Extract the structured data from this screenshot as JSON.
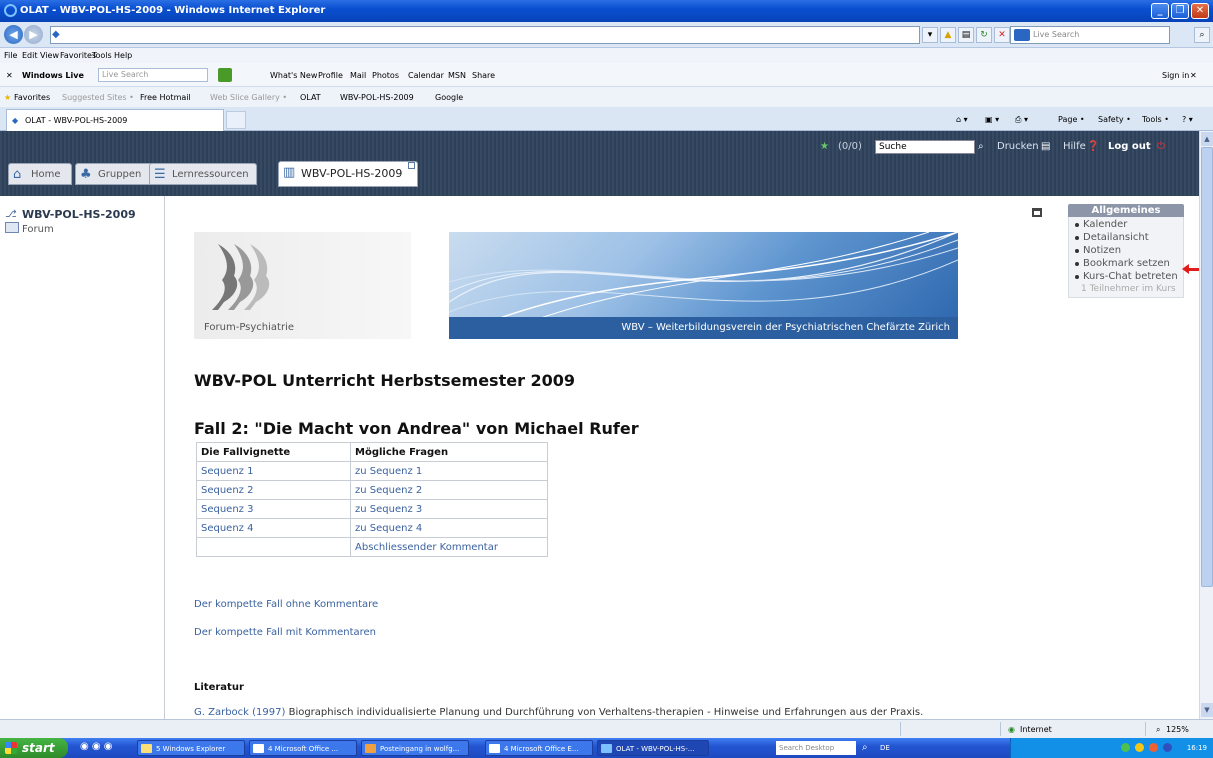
{
  "window": {
    "title": "OLAT - WBV-POL-HS-2009 - Windows Internet Explorer"
  },
  "ie": {
    "menu": [
      "File",
      "Edit",
      "View",
      "Favorites",
      "Tools",
      "Help"
    ],
    "live_search_placeholder": "Live Search",
    "live_toolbar": {
      "brand": "Windows Live",
      "search_placeholder": "Live Search",
      "links": [
        "What's New",
        "Profile",
        "Mail",
        "Photos",
        "Calendar",
        "MSN",
        "Share"
      ],
      "sign_in": "Sign in"
    },
    "favorites": {
      "label": "Favorites",
      "items": [
        "Suggested Sites •",
        "Free Hotmail",
        "Web Slice Gallery •",
        "OLAT",
        "WBV-POL-HS-2009",
        "Google"
      ]
    },
    "tab_title": "OLAT - WBV-POL-HS-2009",
    "commands": [
      "Page •",
      "Safety •",
      "Tools •"
    ]
  },
  "olat": {
    "header": {
      "count": "(0/0)",
      "search_value": "Suche",
      "print": "Drucken",
      "help": "Hilfe",
      "logout": "Log out"
    },
    "tabs": [
      {
        "label": "Home"
      },
      {
        "label": "Gruppen"
      },
      {
        "label": "Lernressourcen"
      },
      {
        "label": "WBV-POL-HS-2009"
      }
    ],
    "nav": {
      "course": "WBV-POL-HS-2009",
      "forum": "Forum"
    },
    "toolbox": {
      "title": "Allgemeines",
      "items": [
        "Kalender",
        "Detailansicht",
        "Notizen",
        "Bookmark setzen",
        "Kurs-Chat betreten"
      ],
      "note": "1 Teilnehmer im Kurs"
    },
    "banner": {
      "left_caption": "Forum-Psychiatrie",
      "right_caption": "WBV – Weiterbildungsverein der Psychiatrischen Chefärzte Zürich"
    },
    "content": {
      "heading": "WBV-POL Unterricht Herbstsemester 2009",
      "case_title": "Fall 2: \"Die Macht von Andrea\" von Michael Rufer",
      "table": {
        "headers": [
          "Die Fallvignette",
          "Mögliche Fragen"
        ],
        "rows": [
          [
            "Sequenz 1",
            "zu Sequenz 1"
          ],
          [
            "Sequenz 2",
            "zu Sequenz 2"
          ],
          [
            "Sequenz 3",
            "zu Sequenz 3"
          ],
          [
            "Sequenz 4",
            "zu Sequenz 4"
          ],
          [
            "",
            "Abschliessender Kommentar"
          ]
        ]
      },
      "link_without": "Der kompette Fall ohne Kommentare",
      "link_with": "Der kompette Fall mit Kommentaren",
      "literature_heading": "Literatur",
      "literature_author": "G. Zarbock (1997)",
      "literature_text": "Biographisch individualisierte Planung und Durchführung von Verhaltens-therapien - Hinweise und Erfahrungen aus der Praxis."
    }
  },
  "statusbar": {
    "zone": "Internet",
    "zoom": "125%"
  },
  "taskbar": {
    "start": "start",
    "items": [
      "5 Windows Explorer",
      "4 Microsoft Office ...",
      "Posteingang in wolfg...",
      "4 Microsoft Office E...",
      "OLAT - WBV-POL-HS-..."
    ],
    "desktop_search": "Search Desktop",
    "lang": "DE",
    "clock": "16:19"
  }
}
